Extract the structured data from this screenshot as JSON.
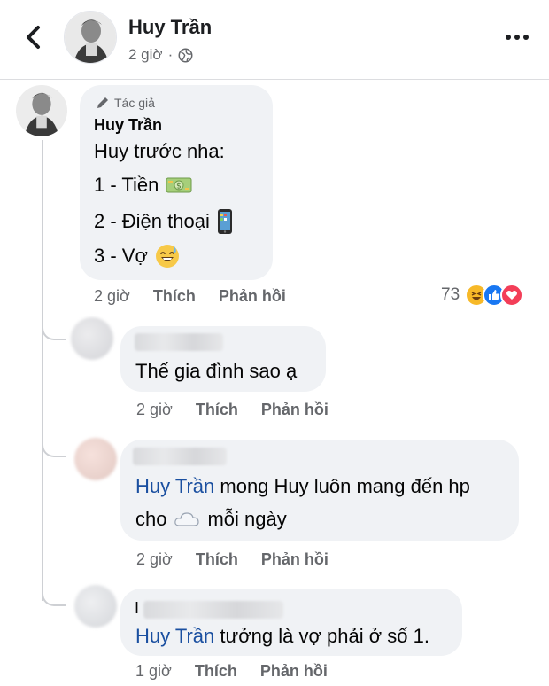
{
  "header": {
    "name": "Huy Trần",
    "time": "2 giờ",
    "separator": "·"
  },
  "author_comment": {
    "badge": "Tác giả",
    "name": "Huy Trần",
    "lines": [
      "Huy trước nha:",
      "1 - Tiền",
      "2 - Điện thoại",
      "3 - Vợ"
    ],
    "emojis": [
      "money-emoji",
      "phone-emoji",
      "sweat-smile-emoji"
    ],
    "time": "2 giờ",
    "like": "Thích",
    "reply": "Phản hồi",
    "reaction_count": "73",
    "reaction_icons": [
      "haha",
      "like",
      "love"
    ]
  },
  "replies": [
    {
      "text": "Thế gia đình sao ạ",
      "time": "2 giờ",
      "like": "Thích",
      "reply": "Phản hồi"
    },
    {
      "mention": "Huy Trần",
      "text_line1": " mong Huy luôn mang đến hp",
      "text_line2_a": "cho",
      "text_line2_b": "mỗi ngày",
      "time": "2 giờ",
      "like": "Thích",
      "reply": "Phản hồi"
    },
    {
      "prefix": "I",
      "mention": "Huy Trần",
      "text": " tưởng là vợ phải ở số 1.",
      "time": "1 giờ",
      "like": "Thích",
      "reply": "Phản hồi"
    }
  ],
  "colors": {
    "mention": "#1a4fa0",
    "bubble": "#f0f2f5",
    "muted": "#65676b",
    "like_blue": "#1877f2",
    "love_red": "#f33e58",
    "haha_yellow": "#f7b928"
  }
}
